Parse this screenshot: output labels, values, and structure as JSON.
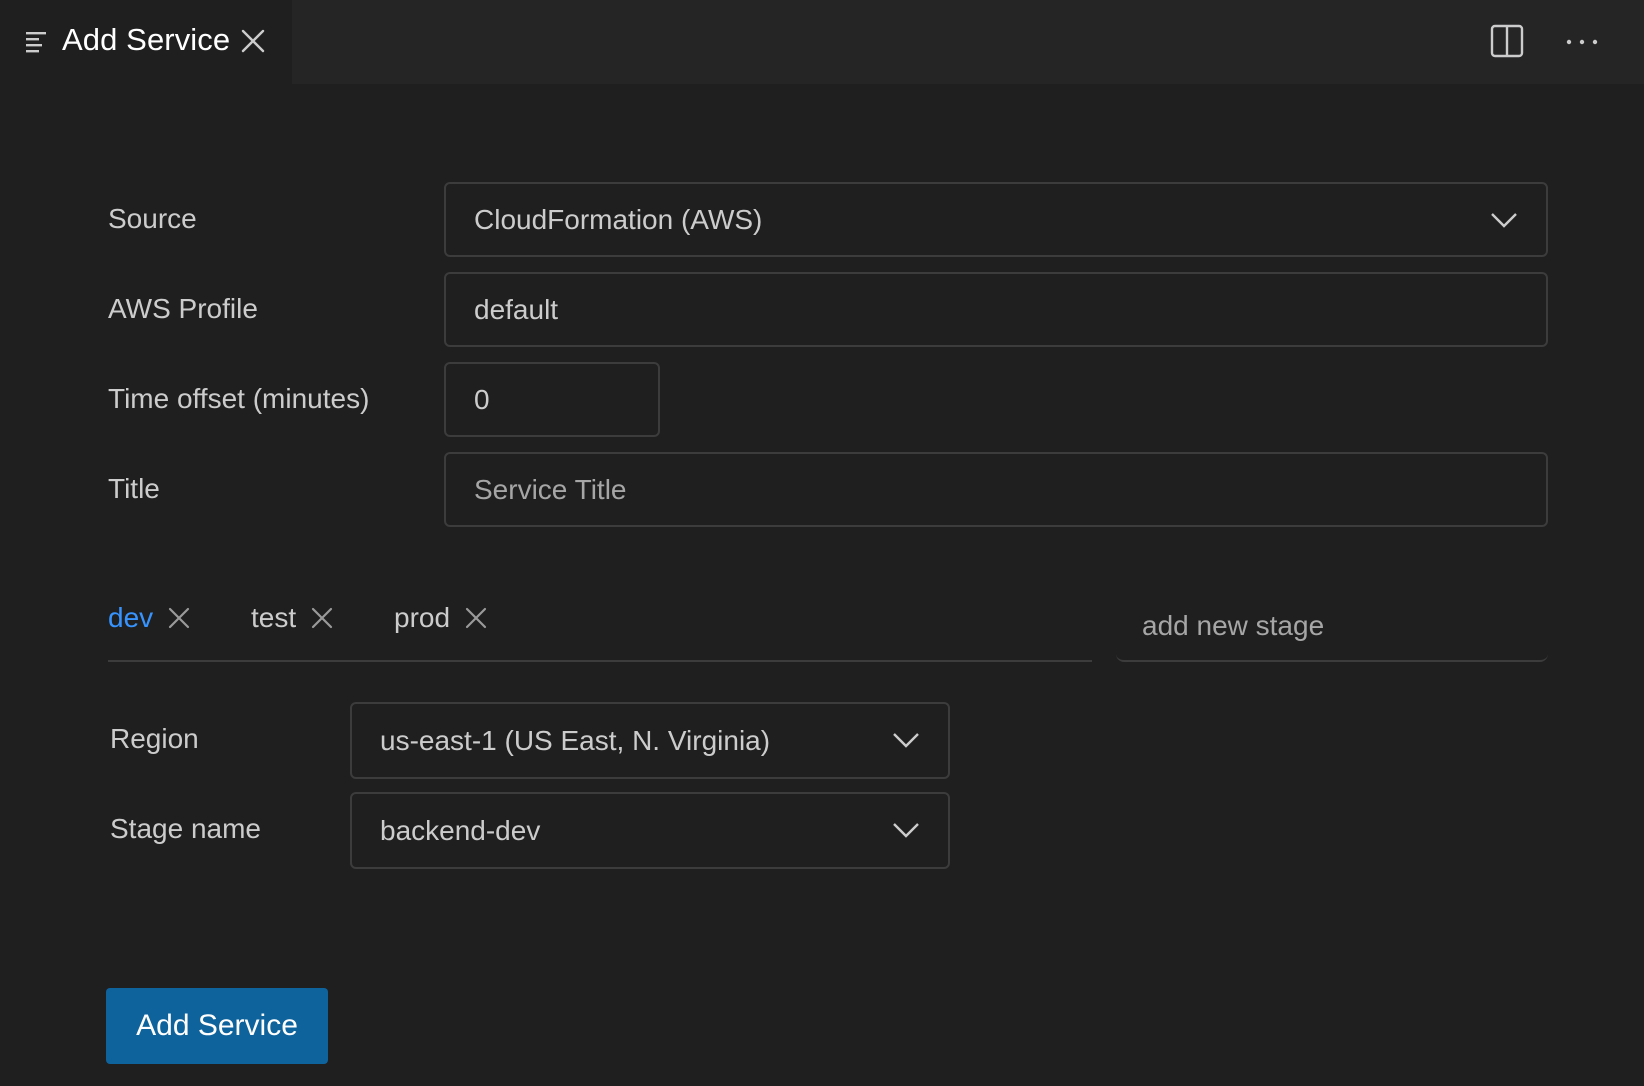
{
  "tab": {
    "title": "Add Service",
    "icon": "lines-icon",
    "close_icon": "close-icon"
  },
  "toolbar": {
    "split_icon": "split-editor-icon",
    "more_icon": "more-actions-icon"
  },
  "form": {
    "source": {
      "label": "Source",
      "value": "CloudFormation (AWS)"
    },
    "aws_profile": {
      "label": "AWS Profile",
      "value": "default"
    },
    "time_offset": {
      "label": "Time offset (minutes)",
      "value": "0"
    },
    "title": {
      "label": "Title",
      "placeholder": "Service Title"
    }
  },
  "stages": {
    "items": [
      {
        "label": "dev",
        "active": true
      },
      {
        "label": "test",
        "active": false
      },
      {
        "label": "prod",
        "active": false
      }
    ],
    "new_stage_placeholder": "add new stage"
  },
  "stage_settings": {
    "region": {
      "label": "Region",
      "value": "us-east-1 (US East, N. Virginia)"
    },
    "stage_name": {
      "label": "Stage name",
      "value": "backend-dev"
    }
  },
  "submit": {
    "label": "Add Service"
  },
  "colors": {
    "background": "#1f1f1f",
    "tabbar": "#252526",
    "accent": "#3794ff",
    "button": "#0e639c",
    "border": "#3c3c3c"
  }
}
